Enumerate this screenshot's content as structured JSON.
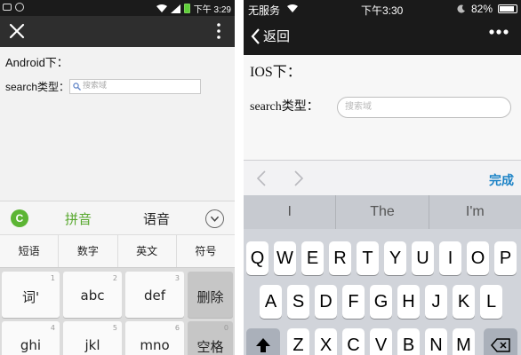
{
  "android": {
    "status": {
      "time": "下午 3:29",
      "icons": [
        "wechat-icon",
        "sync-icon",
        "wifi-icon",
        "signal-icon",
        "battery-icon"
      ]
    },
    "toolbar": {
      "close_icon": "close-icon",
      "more_icon": "more-vertical-icon"
    },
    "page": {
      "title": "Android下：",
      "search_label": "search类型：",
      "search_placeholder": "搜索域"
    },
    "ime": {
      "logo": "C",
      "pinyin": "拼音",
      "voice": "语音",
      "chevron": "chevron-down-icon",
      "modes": [
        "短语",
        "数字",
        "英文",
        "符号"
      ],
      "rows": [
        [
          {
            "label": "词'",
            "num": "1"
          },
          {
            "label": "abc",
            "num": "2"
          },
          {
            "label": "def",
            "num": "3"
          },
          {
            "label": "删除",
            "num": ""
          }
        ],
        [
          {
            "label": "ghi",
            "num": "4"
          },
          {
            "label": "jkl",
            "num": "5"
          },
          {
            "label": "mno",
            "num": "6"
          },
          {
            "label": "空格",
            "num": "0"
          }
        ]
      ]
    },
    "colors": {
      "accent": "#58a82e",
      "toolbar": "#2e2e2e"
    }
  },
  "ios": {
    "status": {
      "carrier": "无服务",
      "time": "下午3:30",
      "battery": "82%"
    },
    "nav": {
      "back_label": "返回",
      "more_icon": "more-horizontal-icon"
    },
    "page": {
      "title": "IOS下：",
      "search_label": "search类型：",
      "search_placeholder": "搜索域"
    },
    "accessory": {
      "prev_icon": "chevron-left-icon",
      "next_icon": "chevron-right-icon",
      "done_label": "完成"
    },
    "suggestions": [
      "I",
      "The",
      "I'm"
    ],
    "keys": {
      "row1": [
        "Q",
        "W",
        "E",
        "R",
        "T",
        "Y",
        "U",
        "I",
        "O",
        "P"
      ],
      "row2": [
        "A",
        "S",
        "D",
        "F",
        "G",
        "H",
        "J",
        "K",
        "L"
      ],
      "row3": [
        "Z",
        "X",
        "C",
        "V",
        "B",
        "N",
        "M"
      ]
    },
    "colors": {
      "accent": "#1a82c6"
    }
  }
}
